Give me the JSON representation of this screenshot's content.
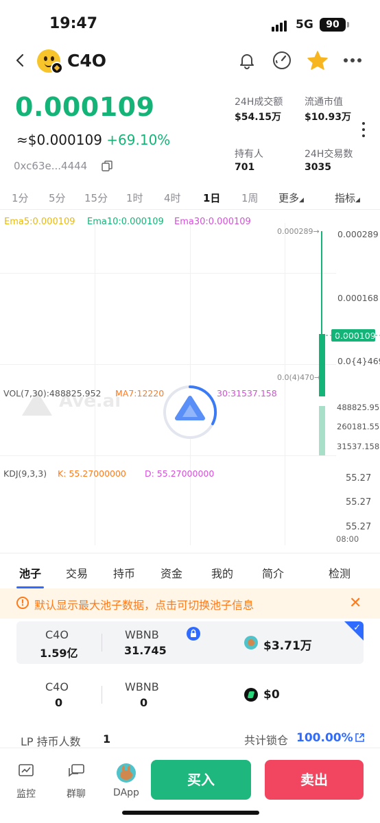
{
  "status_bar": {
    "time": "19:47",
    "network": "5G",
    "battery": "90"
  },
  "header": {
    "token_name": "C4O"
  },
  "price": {
    "main": "0.000109",
    "usd": "≈$0.000109",
    "change": "+69.10%",
    "address": "0xc63e...4444"
  },
  "stats": [
    {
      "label": "24H成交额",
      "value": "$54.15万"
    },
    {
      "label": "流通市值",
      "value": "$10.93万"
    },
    {
      "label": "持有人",
      "value": "701"
    },
    {
      "label": "24H交易数",
      "value": "3035"
    }
  ],
  "timeframes": [
    "1分",
    "5分",
    "15分",
    "1时",
    "4时",
    "1日",
    "1周",
    "更多",
    "指标"
  ],
  "active_timeframe": "1日",
  "chart_data": {
    "type": "candlestick",
    "ema": {
      "ema5": "Ema5:0.000109",
      "ema10": "Ema10:0.000109",
      "ema30": "Ema30:0.000109"
    },
    "price_axis": [
      "0.000289",
      "0.000168",
      "0.000109",
      "0.0{4}469"
    ],
    "high_marker": "0.000289",
    "low_marker": "0.0(4)470",
    "current_price": "0.000109",
    "volume_line": {
      "vol": "VOL(7,30):488825.952",
      "ma7": "MA7:12220",
      "ma30": "30:31537.158"
    },
    "volume_axis": [
      "488825.952",
      "260181.555",
      "31537.158"
    ],
    "kdj_line": {
      "kdj": "KDJ(9,3,3)",
      "k": "K: 55.27000000",
      "d": "D: 55.27000000"
    },
    "kdj_axis": [
      "55.27",
      "55.27",
      "55.27"
    ],
    "time_label": "08:00",
    "candle": {
      "open": 4.7e-05,
      "high": 0.000289,
      "low": 4.7e-05,
      "close": 0.000109,
      "color": "#14b478"
    },
    "volume": 488825.952,
    "watermark": "Ave.ai"
  },
  "tabs": [
    "池子",
    "交易",
    "持币",
    "资金",
    "我的",
    "简介",
    "检测"
  ],
  "notice": {
    "text": "默认显示最大池子数据，点击可切换池子信息"
  },
  "pools": [
    {
      "sym_a": "C4O",
      "amt_a": "1.59亿",
      "sym_b": "WBNB",
      "amt_b": "31.745",
      "usd": "$3.71万"
    },
    {
      "sym_a": "C4O",
      "amt_a": "0",
      "sym_b": "WBNB",
      "amt_b": "0",
      "usd": "$0"
    }
  ],
  "lp": {
    "label": "LP 持币人数",
    "value": "1",
    "lock_label": "共计锁仓",
    "lock_value": "100.00%"
  },
  "bottom_nav": {
    "monitor": "监控",
    "chat": "群聊",
    "dapp": "DApp",
    "buy": "买入",
    "sell": "卖出"
  },
  "colors": {
    "up": "#14b478",
    "down": "#f24660",
    "accent": "#2f6bff",
    "warn": "#ff7a1a"
  }
}
